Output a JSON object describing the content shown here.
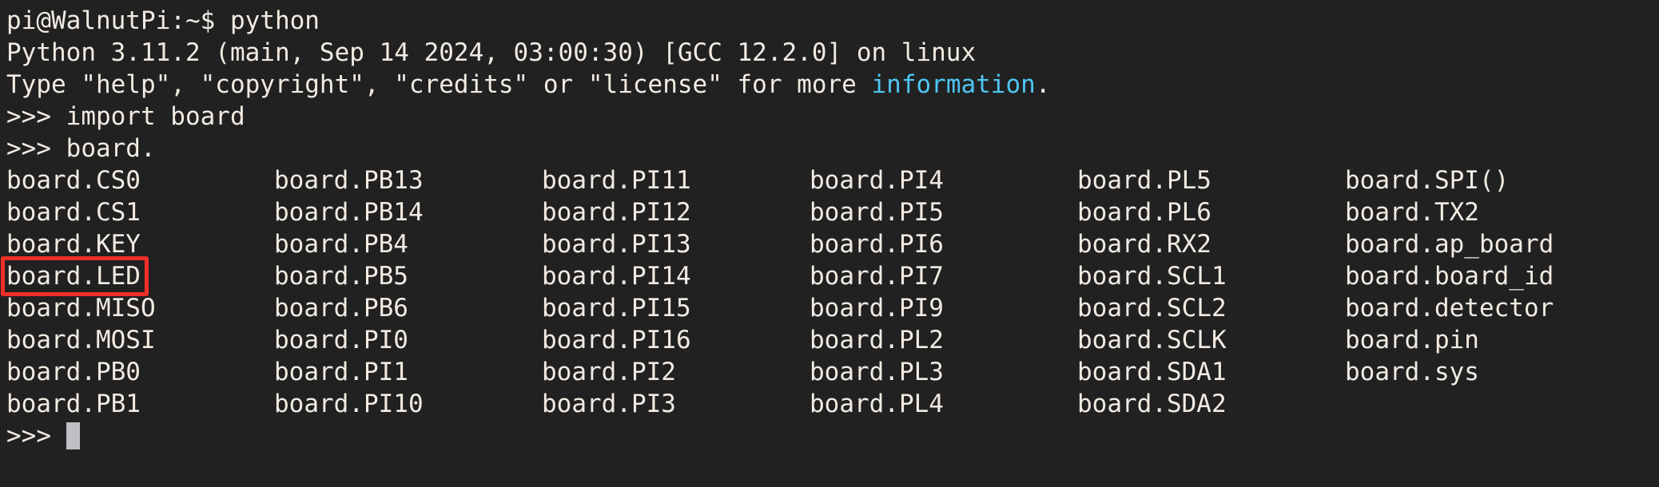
{
  "terminal": {
    "background_color": "#212121",
    "foreground_color": "#f2ebe3",
    "accent_cyan": "#4fc6f2",
    "highlight_color": "#f22f29",
    "prompt_shell": "pi@WalnutPi:~$",
    "prompt_python": ">>>"
  },
  "lines": {
    "shell_prompt": "pi@WalnutPi:~$ python",
    "python_version": "Python 3.11.2 (main, Sep 14 2024, 03:00:30) [GCC 12.2.0] on linux",
    "help_banner_pre": "Type \"help\", \"copyright\", \"credits\" or \"license\" for more ",
    "help_banner_link": "information",
    "help_banner_post": ".",
    "import_line": ">>> import board",
    "completion_line": ">>> board.",
    "final_prompt": ">>> "
  },
  "completion_grid": {
    "column_count": 6,
    "row_count": 8,
    "rows": [
      [
        "board.CS0",
        "board.PB13",
        "board.PI11",
        "board.PI4",
        "board.PL5",
        "board.SPI()"
      ],
      [
        "board.CS1",
        "board.PB14",
        "board.PI12",
        "board.PI5",
        "board.PL6",
        "board.TX2"
      ],
      [
        "board.KEY",
        "board.PB4",
        "board.PI13",
        "board.PI6",
        "board.RX2",
        "board.ap_board"
      ],
      [
        "board.LED",
        "board.PB5",
        "board.PI14",
        "board.PI7",
        "board.SCL1",
        "board.board_id"
      ],
      [
        "board.MISO",
        "board.PB6",
        "board.PI15",
        "board.PI9",
        "board.SCL2",
        "board.detector"
      ],
      [
        "board.MOSI",
        "board.PI0",
        "board.PI16",
        "board.PL2",
        "board.SCLK",
        "board.pin"
      ],
      [
        "board.PB0",
        "board.PI1",
        "board.PI2",
        "board.PL3",
        "board.SDA1",
        "board.sys"
      ],
      [
        "board.PB1",
        "board.PI10",
        "board.PI3",
        "board.PL4",
        "board.SDA2",
        ""
      ]
    ]
  },
  "annotation": {
    "highlighted_item": "board.LED",
    "shape": "rectangle",
    "color": "#f22f29"
  }
}
